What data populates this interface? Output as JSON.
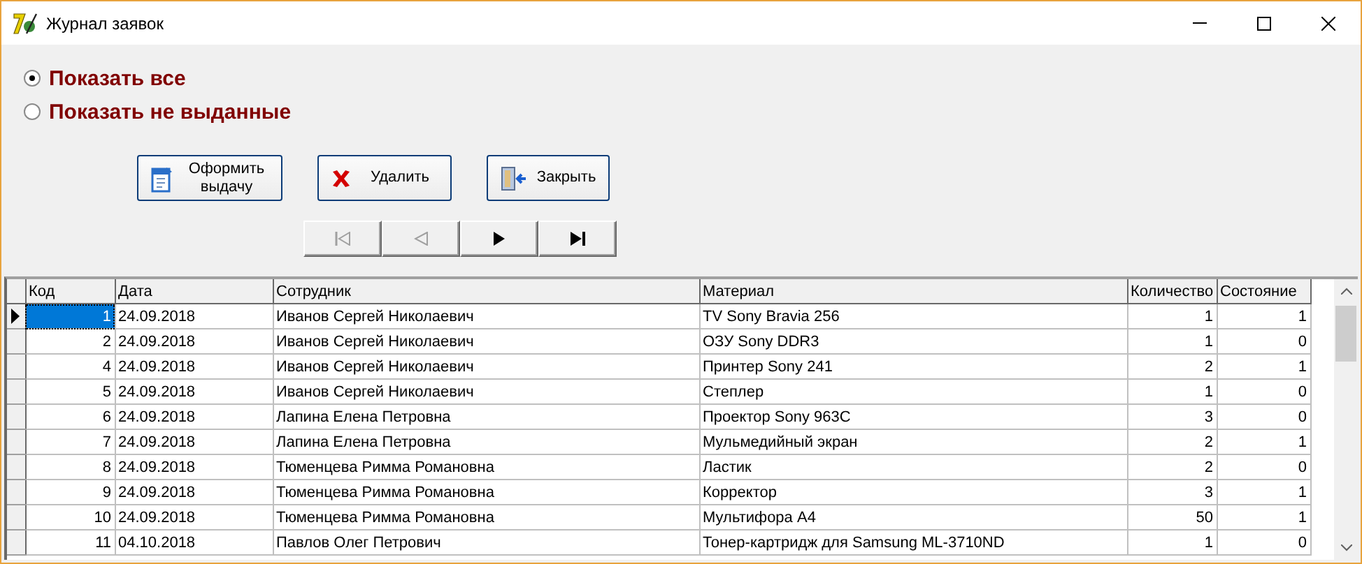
{
  "window": {
    "title": "Журнал заявок"
  },
  "filter": [
    {
      "label": "Показать все",
      "selected": true
    },
    {
      "label": "Показать не выданные",
      "selected": false
    }
  ],
  "buttons": [
    {
      "kind": "issue",
      "label": "Оформить выдачу"
    },
    {
      "kind": "delete",
      "label": "Удалить"
    },
    {
      "kind": "close",
      "label": "Закрыть"
    }
  ],
  "navigator": [
    {
      "kind": "first",
      "disabled": true
    },
    {
      "kind": "prior",
      "disabled": true
    },
    {
      "kind": "next",
      "disabled": false
    },
    {
      "kind": "last",
      "disabled": false
    }
  ],
  "table": {
    "columns": [
      "Код",
      "Дата",
      "Сотрудник",
      "Материал",
      "Количество",
      "Состояние"
    ],
    "rows": [
      {
        "selected": true,
        "cells": [
          "1",
          "24.09.2018",
          "Иванов Сергей Николаевич",
          "TV Sony Bravia 256",
          "1",
          "1"
        ]
      },
      {
        "selected": false,
        "cells": [
          "2",
          "24.09.2018",
          "Иванов Сергей Николаевич",
          "ОЗУ Sony DDR3",
          "1",
          "0"
        ]
      },
      {
        "selected": false,
        "cells": [
          "4",
          "24.09.2018",
          "Иванов Сергей Николаевич",
          "Принтер Sony 241",
          "2",
          "1"
        ]
      },
      {
        "selected": false,
        "cells": [
          "5",
          "24.09.2018",
          "Иванов Сергей Николаевич",
          "Степлер",
          "1",
          "0"
        ]
      },
      {
        "selected": false,
        "cells": [
          "6",
          "24.09.2018",
          "Лапина Елена Петровна",
          "Проектор Sony 963C",
          "3",
          "0"
        ]
      },
      {
        "selected": false,
        "cells": [
          "7",
          "24.09.2018",
          "Лапина Елена Петровна",
          "Мульмедийный экран",
          "2",
          "1"
        ]
      },
      {
        "selected": false,
        "cells": [
          "8",
          "24.09.2018",
          "Тюменцева Римма Романовна",
          "Ластик",
          "2",
          "0"
        ]
      },
      {
        "selected": false,
        "cells": [
          "9",
          "24.09.2018",
          "Тюменцева Римма Романовна",
          "Корректор",
          "3",
          "1"
        ]
      },
      {
        "selected": false,
        "cells": [
          "10",
          "24.09.2018",
          "Тюменцева Римма Романовна",
          "Мультифора А4",
          "50",
          "1"
        ]
      },
      {
        "selected": false,
        "cells": [
          "11",
          "04.10.2018",
          "Павлов Олег Петрович",
          "Тонер-картридж для Samsung ML-3710ND",
          "1",
          "0"
        ]
      }
    ]
  }
}
